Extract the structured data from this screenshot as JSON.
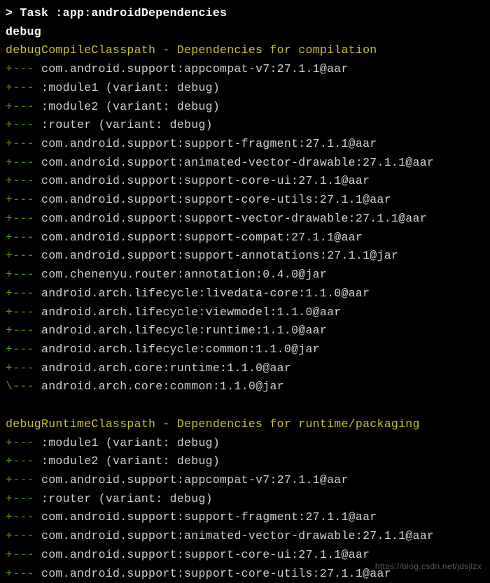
{
  "header": {
    "prompt": ">",
    "task_label": "Task :app:androidDependencies",
    "variant": "debug"
  },
  "section1": {
    "classpath": "debugCompileClasspath",
    "separator": " - ",
    "description": "Dependencies for compilation",
    "deps": [
      {
        "prefix": "+--- ",
        "text": "com.android.support:appcompat-v7:27.1.1@aar"
      },
      {
        "prefix": "+--- ",
        "text": ":module1 (variant: debug)"
      },
      {
        "prefix": "+--- ",
        "text": ":module2 (variant: debug)"
      },
      {
        "prefix": "+--- ",
        "text": ":router (variant: debug)"
      },
      {
        "prefix": "+--- ",
        "text": "com.android.support:support-fragment:27.1.1@aar"
      },
      {
        "prefix": "+--- ",
        "text": "com.android.support:animated-vector-drawable:27.1.1@aar"
      },
      {
        "prefix": "+--- ",
        "text": "com.android.support:support-core-ui:27.1.1@aar"
      },
      {
        "prefix": "+--- ",
        "text": "com.android.support:support-core-utils:27.1.1@aar"
      },
      {
        "prefix": "+--- ",
        "text": "com.android.support:support-vector-drawable:27.1.1@aar"
      },
      {
        "prefix": "+--- ",
        "text": "com.android.support:support-compat:27.1.1@aar"
      },
      {
        "prefix": "+--- ",
        "text": "com.android.support:support-annotations:27.1.1@jar"
      },
      {
        "prefix": "+--- ",
        "text": "com.chenenyu.router:annotation:0.4.0@jar"
      },
      {
        "prefix": "+--- ",
        "text": "android.arch.lifecycle:livedata-core:1.1.0@aar"
      },
      {
        "prefix": "+--- ",
        "text": "android.arch.lifecycle:viewmodel:1.1.0@aar"
      },
      {
        "prefix": "+--- ",
        "text": "android.arch.lifecycle:runtime:1.1.0@aar"
      },
      {
        "prefix": "+--- ",
        "text": "android.arch.lifecycle:common:1.1.0@jar"
      },
      {
        "prefix": "+--- ",
        "text": "android.arch.core:runtime:1.1.0@aar"
      },
      {
        "prefix": "\\--- ",
        "text": "android.arch.core:common:1.1.0@jar"
      }
    ]
  },
  "section2": {
    "classpath": "debugRuntimeClasspath",
    "separator": " - ",
    "description": "Dependencies for runtime/packaging",
    "deps": [
      {
        "prefix": "+--- ",
        "text": ":module1 (variant: debug)"
      },
      {
        "prefix": "+--- ",
        "text": ":module2 (variant: debug)"
      },
      {
        "prefix": "+--- ",
        "text": "com.android.support:appcompat-v7:27.1.1@aar"
      },
      {
        "prefix": "+--- ",
        "text": ":router (variant: debug)"
      },
      {
        "prefix": "+--- ",
        "text": "com.android.support:support-fragment:27.1.1@aar"
      },
      {
        "prefix": "+--- ",
        "text": "com.android.support:animated-vector-drawable:27.1.1@aar"
      },
      {
        "prefix": "+--- ",
        "text": "com.android.support:support-core-ui:27.1.1@aar"
      },
      {
        "prefix": "+--- ",
        "text": "com.android.support:support-core-utils:27.1.1@aar"
      }
    ]
  },
  "watermark": "https://blog.csdn.net/jdsjlzx"
}
